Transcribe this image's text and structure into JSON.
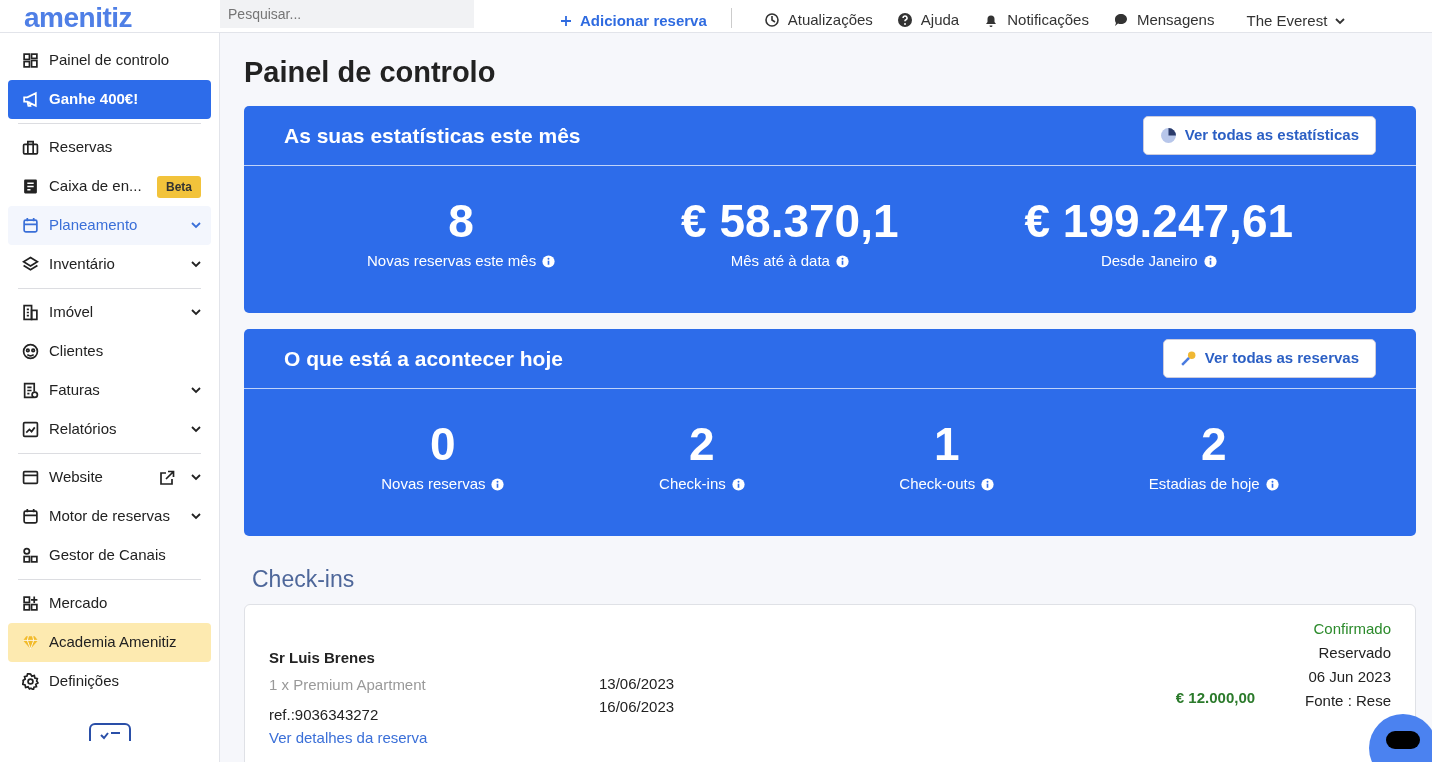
{
  "header": {
    "logo": "amenitiz",
    "search": {
      "placeholder": "Pesquisar..."
    },
    "add_button": "Adicionar reserva",
    "links": [
      {
        "label": "Atualizações"
      },
      {
        "label": "Ajuda"
      },
      {
        "label": "Notificações"
      },
      {
        "label": "Mensagens"
      }
    ],
    "property": "The Everest"
  },
  "sidebar": {
    "groups": [
      [
        {
          "label": "Painel de controlo",
          "kind": "plain",
          "hovered": false,
          "expandable": false,
          "external": false
        },
        {
          "label": "Ganhe 400€!",
          "kind": "promo",
          "hovered": false,
          "expandable": false,
          "external": false
        }
      ],
      [
        {
          "label": "Reservas",
          "kind": "plain",
          "hovered": false,
          "expandable": false,
          "external": false
        },
        {
          "label": "Caixa de en...",
          "kind": "plain",
          "badge": "Beta",
          "hovered": false,
          "expandable": false,
          "external": false
        },
        {
          "label": "Planeamento",
          "kind": "plain",
          "hovered": true,
          "expandable": true,
          "external": false
        },
        {
          "label": "Inventário",
          "kind": "plain",
          "hovered": false,
          "expandable": true,
          "external": false
        }
      ],
      [
        {
          "label": "Imóvel",
          "kind": "plain",
          "hovered": false,
          "expandable": true,
          "external": false
        },
        {
          "label": "Clientes",
          "kind": "plain",
          "hovered": false,
          "expandable": false,
          "external": false
        },
        {
          "label": "Faturas",
          "kind": "plain",
          "hovered": false,
          "expandable": true,
          "external": false
        },
        {
          "label": "Relatórios",
          "kind": "plain",
          "hovered": false,
          "expandable": true,
          "external": false
        }
      ],
      [
        {
          "label": "Website",
          "kind": "plain",
          "hovered": false,
          "expandable": true,
          "external": true
        },
        {
          "label": "Motor de reservas",
          "kind": "plain",
          "hovered": false,
          "expandable": true,
          "external": false
        },
        {
          "label": "Gestor de Canais",
          "kind": "plain",
          "hovered": false,
          "expandable": false,
          "external": false
        }
      ],
      [
        {
          "label": "Mercado",
          "kind": "plain",
          "hovered": false,
          "expandable": false,
          "external": false
        },
        {
          "label": "Academia Amenitiz",
          "kind": "academy",
          "hovered": false,
          "expandable": false,
          "external": false
        },
        {
          "label": "Definições",
          "kind": "plain",
          "hovered": false,
          "expandable": false,
          "external": false
        }
      ]
    ]
  },
  "page_title": "Painel de controlo",
  "panels": [
    {
      "title": "As suas estatísticas este mês",
      "button": "Ver todas as estatísticas",
      "stats": [
        {
          "value": "8",
          "label": "Novas reservas este mês"
        },
        {
          "value": "€ 58.370,1",
          "label": "Mês até à data"
        },
        {
          "value": "€ 199.247,61",
          "label": "Desde Janeiro"
        }
      ]
    },
    {
      "title": "O que está a acontecer hoje",
      "button": "Ver todas as reservas",
      "stats": [
        {
          "value": "0",
          "label": "Novas reservas"
        },
        {
          "value": "2",
          "label": "Check-ins"
        },
        {
          "value": "1",
          "label": "Check-outs"
        },
        {
          "value": "2",
          "label": "Estadias de hoje"
        }
      ]
    }
  ],
  "checkins": {
    "title": "Check-ins",
    "booking": {
      "guest": "Sr Luis Brenes",
      "room": "1 x Premium Apartment",
      "ref": "ref.:9036343272",
      "link": "Ver detalhes da reserva",
      "dates": [
        "13/06/2023",
        "16/06/2023"
      ],
      "amount": "€ 12.000,00",
      "status": "Confirmado",
      "info": [
        "Reservado",
        "06 Jun 2023",
        "Fonte : Rese"
      ]
    }
  }
}
